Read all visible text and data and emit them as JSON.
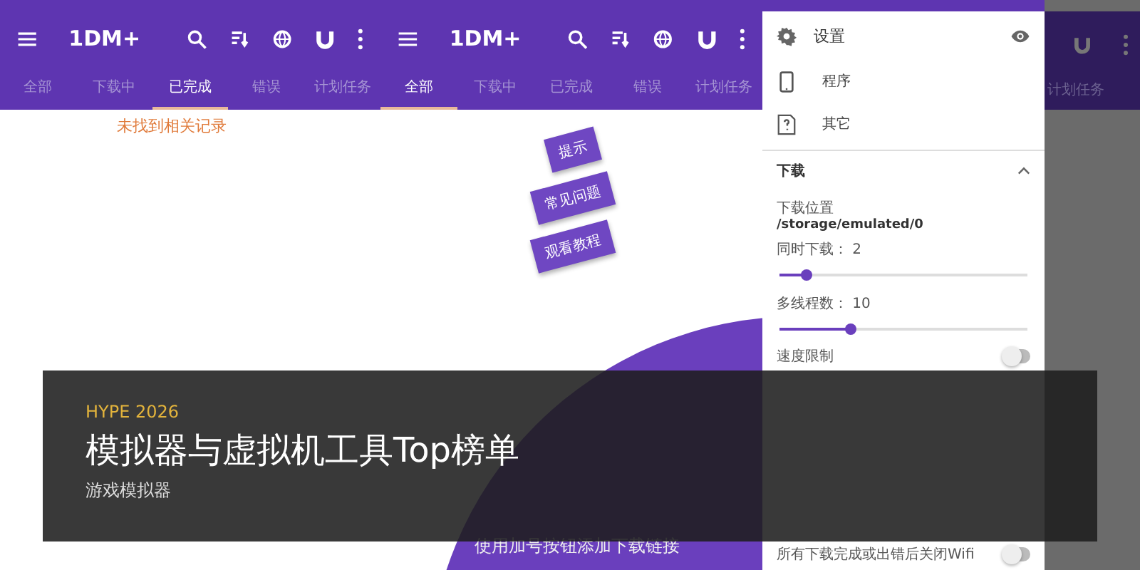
{
  "screens": [
    {
      "app_bar": {
        "title": "1DM+"
      },
      "tabs": [
        {
          "label": "全部",
          "selected": false
        },
        {
          "label": "下载中",
          "selected": false
        },
        {
          "label": "已完成",
          "selected": true
        },
        {
          "label": "错误",
          "selected": false
        },
        {
          "label": "计划任务",
          "selected": false
        }
      ],
      "empty_message": "未找到相关记录"
    },
    {
      "app_bar": {
        "title": "1DM+"
      },
      "tabs": [
        {
          "label": "全部",
          "selected": true
        },
        {
          "label": "下载中",
          "selected": false
        },
        {
          "label": "已完成",
          "selected": false
        },
        {
          "label": "错误",
          "selected": false
        },
        {
          "label": "计划任务",
          "selected": false
        }
      ],
      "hint_buttons": [
        "提示",
        "常见问题",
        "观看教程"
      ],
      "add_hint": "使用加号按钮添加下载链接"
    }
  ],
  "drawer_screen": {
    "background_tab": "计划任务",
    "drawer": {
      "title": "设置",
      "items": [
        {
          "kind": "phone",
          "label": "程序"
        },
        {
          "kind": "help",
          "label": "其它"
        }
      ],
      "section": {
        "title": "下载",
        "expanded": true
      },
      "location_label": "下载位置",
      "location_value": "/storage/emulated/0",
      "settings": [
        {
          "kind": "slider",
          "label": "同时下载：",
          "value": "2",
          "level": 0.11
        },
        {
          "kind": "slider",
          "label": "多线程数：",
          "value": "10",
          "level": 0.29
        },
        {
          "kind": "toggle",
          "label": "速度限制",
          "on": false
        }
      ],
      "footer_settings": [
        {
          "kind": "toggle",
          "label": "所有下载完成或出错后关闭Wifi",
          "on": false
        }
      ]
    }
  },
  "banner": {
    "kicker": "HYPE 2026",
    "title": "模拟器与虚拟机工具Top榜单",
    "subtitle": "游戏模拟器"
  }
}
